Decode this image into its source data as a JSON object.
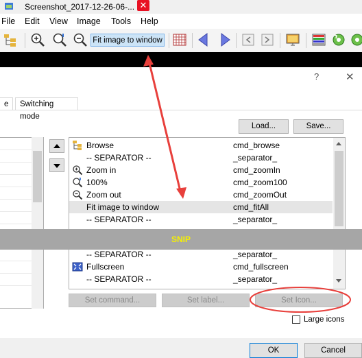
{
  "window": {
    "title": "Screenshot_2017-12-26-06-...",
    "close_glyph": "✕"
  },
  "menubar": [
    "File",
    "Edit",
    "View",
    "Image",
    "Tools",
    "Help"
  ],
  "toolbar": {
    "fit_label": "Fit image to window",
    "icons": [
      "folders-icon",
      "zoom-in-icon",
      "zoom-100-icon",
      "zoom-out-icon",
      "grid-icon",
      "arrow-left-icon",
      "arrow-right-icon",
      "prev-page-icon",
      "next-page-icon",
      "slideshow-icon",
      "palette-icon",
      "rotate-left-icon",
      "rotate-right-icon"
    ]
  },
  "dialog": {
    "help_glyph": "?",
    "close_glyph": "✕",
    "tabs": [
      "e",
      "Switching mode"
    ],
    "load_label": "Load...",
    "save_label": "Save...",
    "snip_label": "SNIP",
    "set_command_label": "Set command...",
    "set_label_label": "Set label...",
    "set_icon_label": "Set Icon...",
    "large_icons_label": "Large icons",
    "large_icons_checked": false,
    "ok_label": "OK",
    "cancel_label": "Cancel"
  },
  "commands": [
    {
      "name": "Browse",
      "cmd": "cmd_browse",
      "icon": "browse-icon"
    },
    {
      "name": "-- SEPARATOR --",
      "cmd": "_separator_",
      "icon": ""
    },
    {
      "name": "Zoom in",
      "cmd": "cmd_zoomIn",
      "icon": "zoom-in-icon"
    },
    {
      "name": "100%",
      "cmd": "cmd_zoom100",
      "icon": "zoom-100-icon"
    },
    {
      "name": "Zoom out",
      "cmd": "cmd_zoomOut",
      "icon": "zoom-out-icon"
    },
    {
      "name": "Fit image to window",
      "cmd": "cmd_fitAll",
      "icon": "",
      "selected": true
    },
    {
      "name": "-- SEPARATOR --",
      "cmd": "_separator_",
      "icon": ""
    },
    {
      "name": "-- SEPARATOR --",
      "cmd": "_separator_",
      "icon": ""
    },
    {
      "name": "Fullscreen",
      "cmd": "cmd_fullscreen",
      "icon": "fullscreen-icon"
    },
    {
      "name": "-- SEPARATOR --",
      "cmd": "_separator_",
      "icon": ""
    }
  ],
  "annotation_color": "#e8403c"
}
